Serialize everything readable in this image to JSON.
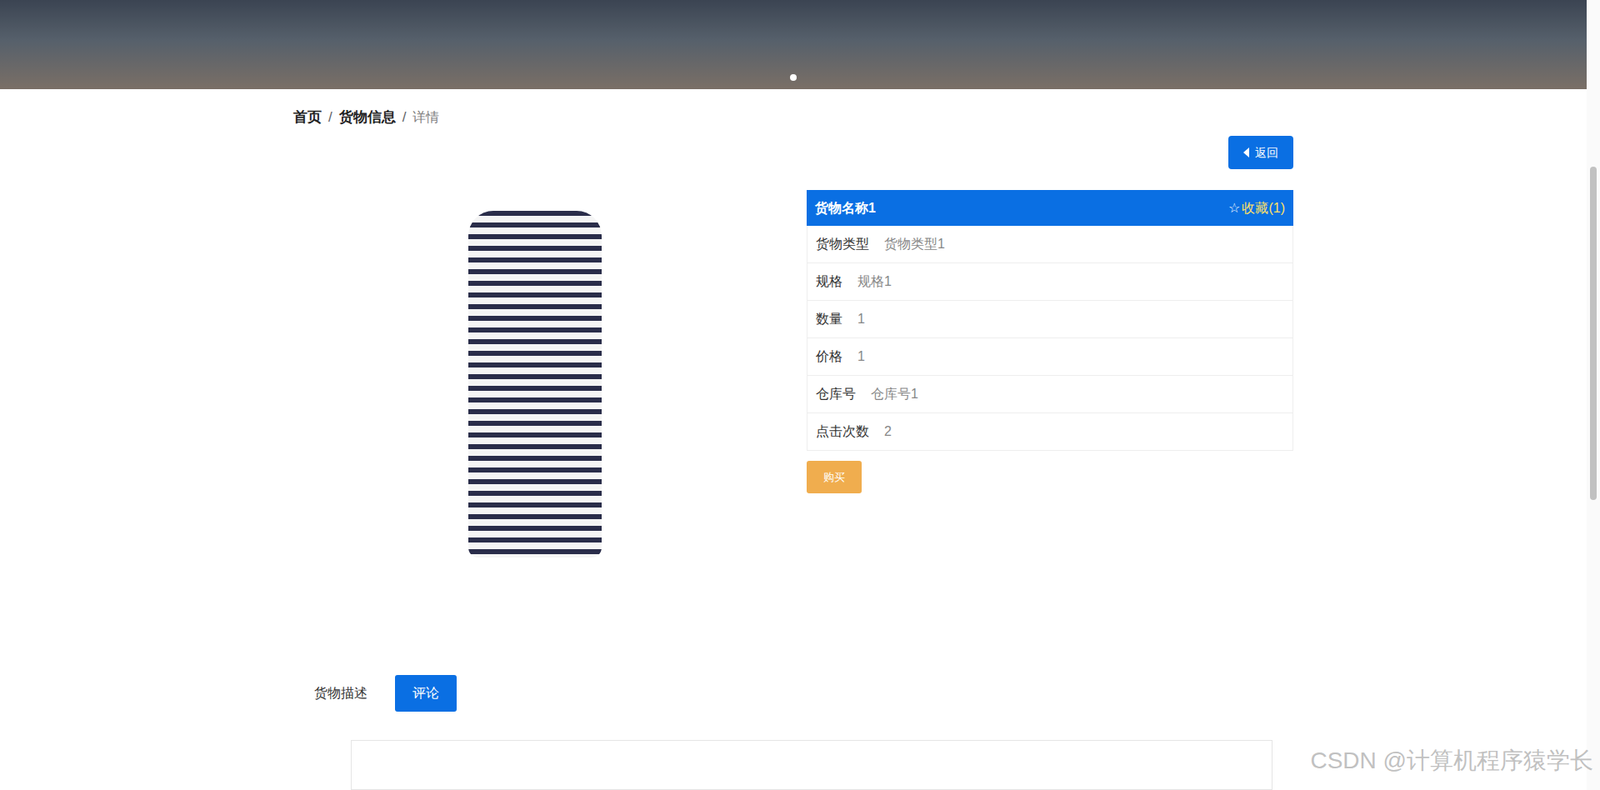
{
  "banner": {
    "carousel_dots": [
      {
        "selected": true
      }
    ]
  },
  "breadcrumb": {
    "separator": "/",
    "items": [
      {
        "label": "首页",
        "selected": false
      },
      {
        "label": "货物信息",
        "selected": false
      },
      {
        "label": "详情",
        "selected": true
      }
    ]
  },
  "back_button": {
    "label": "返回"
  },
  "product": {
    "name": "货物名称1",
    "favorite": {
      "icon": "☆",
      "label": "收藏(1)"
    },
    "fields": [
      {
        "label": "货物类型",
        "value": "货物类型1"
      },
      {
        "label": "规格",
        "value": "规格1"
      },
      {
        "label": "数量",
        "value": "1"
      },
      {
        "label": "价格",
        "value": "1"
      },
      {
        "label": "仓库号",
        "value": "仓库号1"
      },
      {
        "label": "点击次数",
        "value": "2"
      }
    ],
    "buy_button": "购买"
  },
  "tabs": [
    {
      "label": "货物描述",
      "selected": false
    },
    {
      "label": "评论",
      "selected": true
    }
  ],
  "watermark": "CSDN @计算机程序猿学长"
}
